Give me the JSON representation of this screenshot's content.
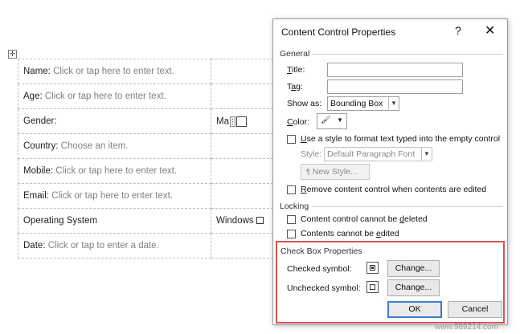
{
  "document": {
    "move_handle_glyph": "✛",
    "rows": [
      {
        "label": "Name:",
        "placeholder": "Click or tap here to enter text.",
        "right": ""
      },
      {
        "label": "Age:",
        "placeholder": "Click or tap here to enter text.",
        "right": ""
      },
      {
        "label": "Gender:",
        "placeholder": "",
        "right": "Ma"
      },
      {
        "label": "Country:",
        "placeholder": "Choose an item.",
        "right": ""
      },
      {
        "label": "Mobile:",
        "placeholder": "Click or tap here to enter text.",
        "right": ""
      },
      {
        "label": "Email:",
        "placeholder": "Click or tap here to enter text.",
        "right": ""
      },
      {
        "label": "Operating System",
        "placeholder": "",
        "right": "Windows"
      },
      {
        "label": "Date:",
        "placeholder": "Click or tap to enter a date.",
        "right": ""
      }
    ]
  },
  "dialog": {
    "title": "Content Control Properties",
    "help": "?",
    "close": "✕",
    "general": {
      "section": "General",
      "title_label": "Title:",
      "title_accel": "T",
      "title_rest": "itle:",
      "tag_accel": "a",
      "tag_pre": "T",
      "tag_post": "g:",
      "show_as_pre": "Show as:",
      "show_as_value": "Bounding Box",
      "color_accel": "C",
      "color_rest": "olor:",
      "color_glyph": "🖌",
      "use_style_accel": "U",
      "use_style_rest": "se a style to format text typed into the empty control",
      "style_label": "Style:",
      "style_value": "Default Paragraph Font",
      "new_style": "New Style...",
      "remove_accel": "R",
      "remove_rest": "emove content control when contents are edited"
    },
    "locking": {
      "section": "Locking",
      "cannot_delete_pre": "Content control cannot be ",
      "cannot_delete_accel": "d",
      "cannot_delete_post": "eleted",
      "cannot_edit_pre": "Contents cannot be ",
      "cannot_edit_accel": "e",
      "cannot_edit_post": "dited"
    },
    "checkbox": {
      "section": "Check Box Properties",
      "checked_label": "Checked symbol:",
      "unchecked_label": "Unchecked symbol:",
      "change_1": "Change...",
      "change_2": "Change..."
    },
    "ok": "OK",
    "cancel": "Cancel"
  },
  "watermark": "www.989214.com",
  "colors": {
    "highlight": "#d9534f",
    "default_button_border": "#3c7fd3"
  }
}
